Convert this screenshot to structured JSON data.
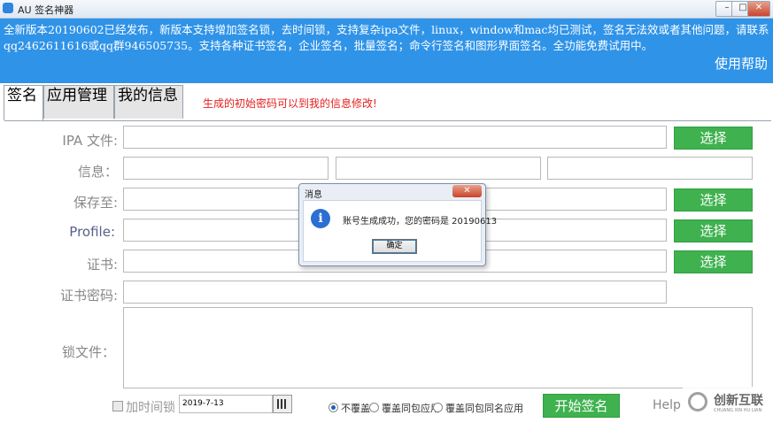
{
  "window": {
    "title": "AU 签名神器",
    "min_label": "–",
    "max_label": "□",
    "close_label": "✕"
  },
  "banner": {
    "notice": "全新版本20190602已经发布，新版本支持增加签名锁，去时间锁，支持复杂ipa文件，linux，window和mac均已测试，签名无法效或者其他问题，请联系qq2462611616或qq群946505735。支持各种证书签名，企业签名，批量签名；命令行签名和图形界面签名。全功能免费试用中。",
    "help": "使用帮助"
  },
  "tabs": [
    {
      "label": "签名"
    },
    {
      "label": "应用管理"
    },
    {
      "label": "我的信息"
    }
  ],
  "tab_hint": "生成的初始密码可以到我的信息修改!",
  "form": {
    "ipa_label": "IPA 文件:",
    "info_label": "信息：",
    "save_label": "保存至:",
    "profile_label": "Profile:",
    "cert_label": "证书:",
    "cert_pwd_label": "证书密码:",
    "lock_label": "锁文件：",
    "choose": "选择"
  },
  "bottom": {
    "time_lock_label": "加时间锁",
    "date_value": "2019-7-13",
    "radio_options": [
      "不覆盖",
      "覆盖同包应用",
      "覆盖同包同名应用"
    ],
    "start_button": "开始签名",
    "help": "Help"
  },
  "dialog": {
    "title": "消息",
    "close_label": "✕",
    "icon": "info-icon",
    "message": "账号生成成功，您的密码是 20190613",
    "ok_button": "确定"
  },
  "watermark": {
    "text": "创新互联",
    "sub": "CHUANG XIN HU LIAN"
  },
  "colors": {
    "banner": "#2f93e8",
    "button_green": "#3fb24f",
    "hint_red": "#e62020"
  }
}
